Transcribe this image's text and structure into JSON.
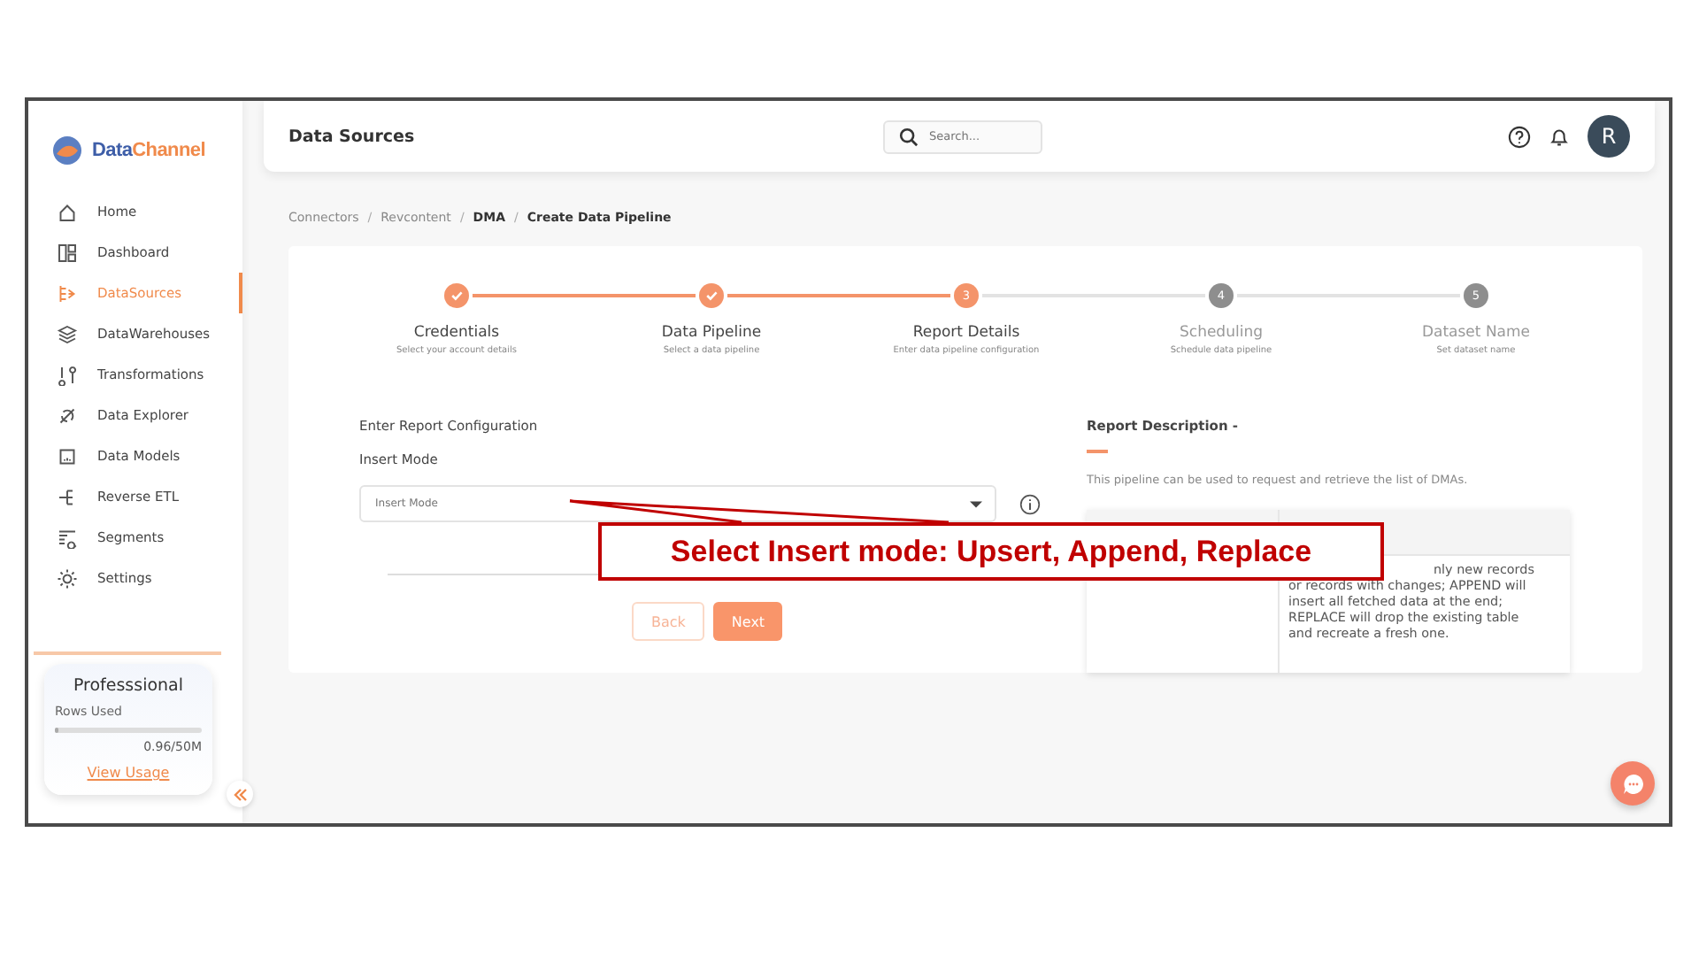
{
  "sidebar": {
    "logo": {
      "first": "Data",
      "second": "Channel"
    },
    "items": [
      {
        "label": "Home",
        "selected": false
      },
      {
        "label": "Dashboard",
        "selected": false
      },
      {
        "label": "DataSources",
        "selected": true
      },
      {
        "label": "DataWarehouses",
        "selected": false
      },
      {
        "label": "Transformations",
        "selected": false
      },
      {
        "label": "Data Explorer",
        "selected": false
      },
      {
        "label": "Data Models",
        "selected": false
      },
      {
        "label": "Reverse ETL",
        "selected": false
      },
      {
        "label": "Segments",
        "selected": false
      },
      {
        "label": "Settings",
        "selected": false
      }
    ],
    "plan": {
      "name": "Professsional",
      "rows_label": "Rows Used",
      "level": 0.02,
      "usage": "0.96/50M",
      "link": "View Usage"
    }
  },
  "header": {
    "title": "Data Sources",
    "search": {
      "placeholder": "Search..."
    },
    "avatar": "R"
  },
  "breadcrumb": [
    {
      "label": "Connectors",
      "link": true
    },
    {
      "separator": "/",
      "label": "Revcontent",
      "link": true
    },
    {
      "separator": "/",
      "label": "DMA",
      "link": false
    },
    {
      "separator": "/",
      "label": "Create Data Pipeline",
      "link": false
    }
  ],
  "steps": [
    {
      "title": "Credentials",
      "subtitle": "Select your account details",
      "done": true
    },
    {
      "title": "Data Pipeline",
      "subtitle": "Select a data pipeline",
      "done": true
    },
    {
      "number": "3",
      "title": "Report Details",
      "subtitle": "Enter data pipeline configuration",
      "done": false,
      "current": true
    },
    {
      "number": "4",
      "title": "Scheduling",
      "subtitle": "Schedule data pipeline",
      "done": false,
      "current": false
    },
    {
      "number": "5",
      "title": "Dataset Name",
      "subtitle": "Set dataset name",
      "done": false,
      "current": false
    }
  ],
  "form": {
    "heading": "Enter Report Configuration",
    "field_label": "Insert Mode",
    "field": {
      "placeholder": "Insert Mode"
    },
    "buttons": [
      {
        "label": "Back",
        "kind": "outline"
      },
      {
        "label": "Next",
        "kind": "primary"
      }
    ]
  },
  "description": {
    "title": "Report Description -",
    "text": "This pipeline can be used to request and retrieve the list of DMAs.",
    "table_lines": [
      "nly new records",
      "or records with changes; APPEND will",
      "insert all fetched data at the end;",
      "REPLACE will drop the existing table",
      "and recreate a fresh one."
    ]
  },
  "annotation": "Select Insert mode: Upsert, Append, Replace"
}
